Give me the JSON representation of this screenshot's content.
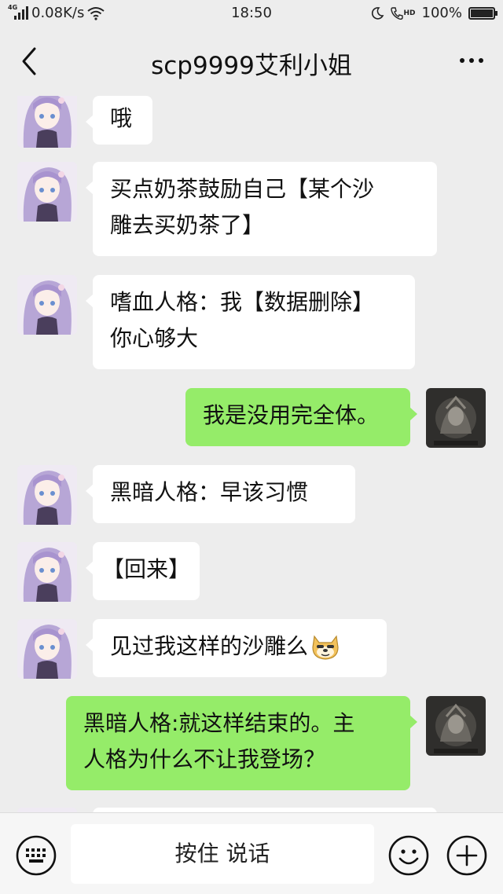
{
  "status_bar": {
    "network_type": "4G",
    "speed": "0.08K/s",
    "time": "18:50",
    "hd_label": "HD",
    "battery": "100%",
    "battery_level": 1.0
  },
  "header": {
    "title": "scp9999艾利小姐"
  },
  "messages": [
    {
      "side": "in",
      "lines": [
        "哦"
      ]
    },
    {
      "side": "in",
      "lines": [
        "买点奶茶鼓励自己【某个沙",
        "雕去买奶茶了】"
      ]
    },
    {
      "side": "in",
      "lines": [
        "嗜血人格：我【数据删除】",
        "你心够大"
      ]
    },
    {
      "side": "out",
      "lines": [
        "我是没用完全体。"
      ]
    },
    {
      "side": "in",
      "lines": [
        "黑暗人格：早该习惯"
      ]
    },
    {
      "side": "in",
      "lines": [
        "【回来】"
      ]
    },
    {
      "side": "in",
      "lines": [
        "见过我这样的沙雕么"
      ],
      "emoji": "doge-emoji"
    },
    {
      "side": "out",
      "lines": [
        "黑暗人格:就这样结束的。主",
        "人格为什么不让我登场？"
      ]
    }
  ],
  "input_bar": {
    "voice_label": "按住 说话",
    "icons": [
      "keyboard-icon",
      "emoji-icon",
      "plus-icon"
    ]
  },
  "colors": {
    "background": "#ededed",
    "bubble_incoming": "#ffffff",
    "bubble_outgoing": "#95ec69",
    "input_bar": "#f6f6f6"
  }
}
